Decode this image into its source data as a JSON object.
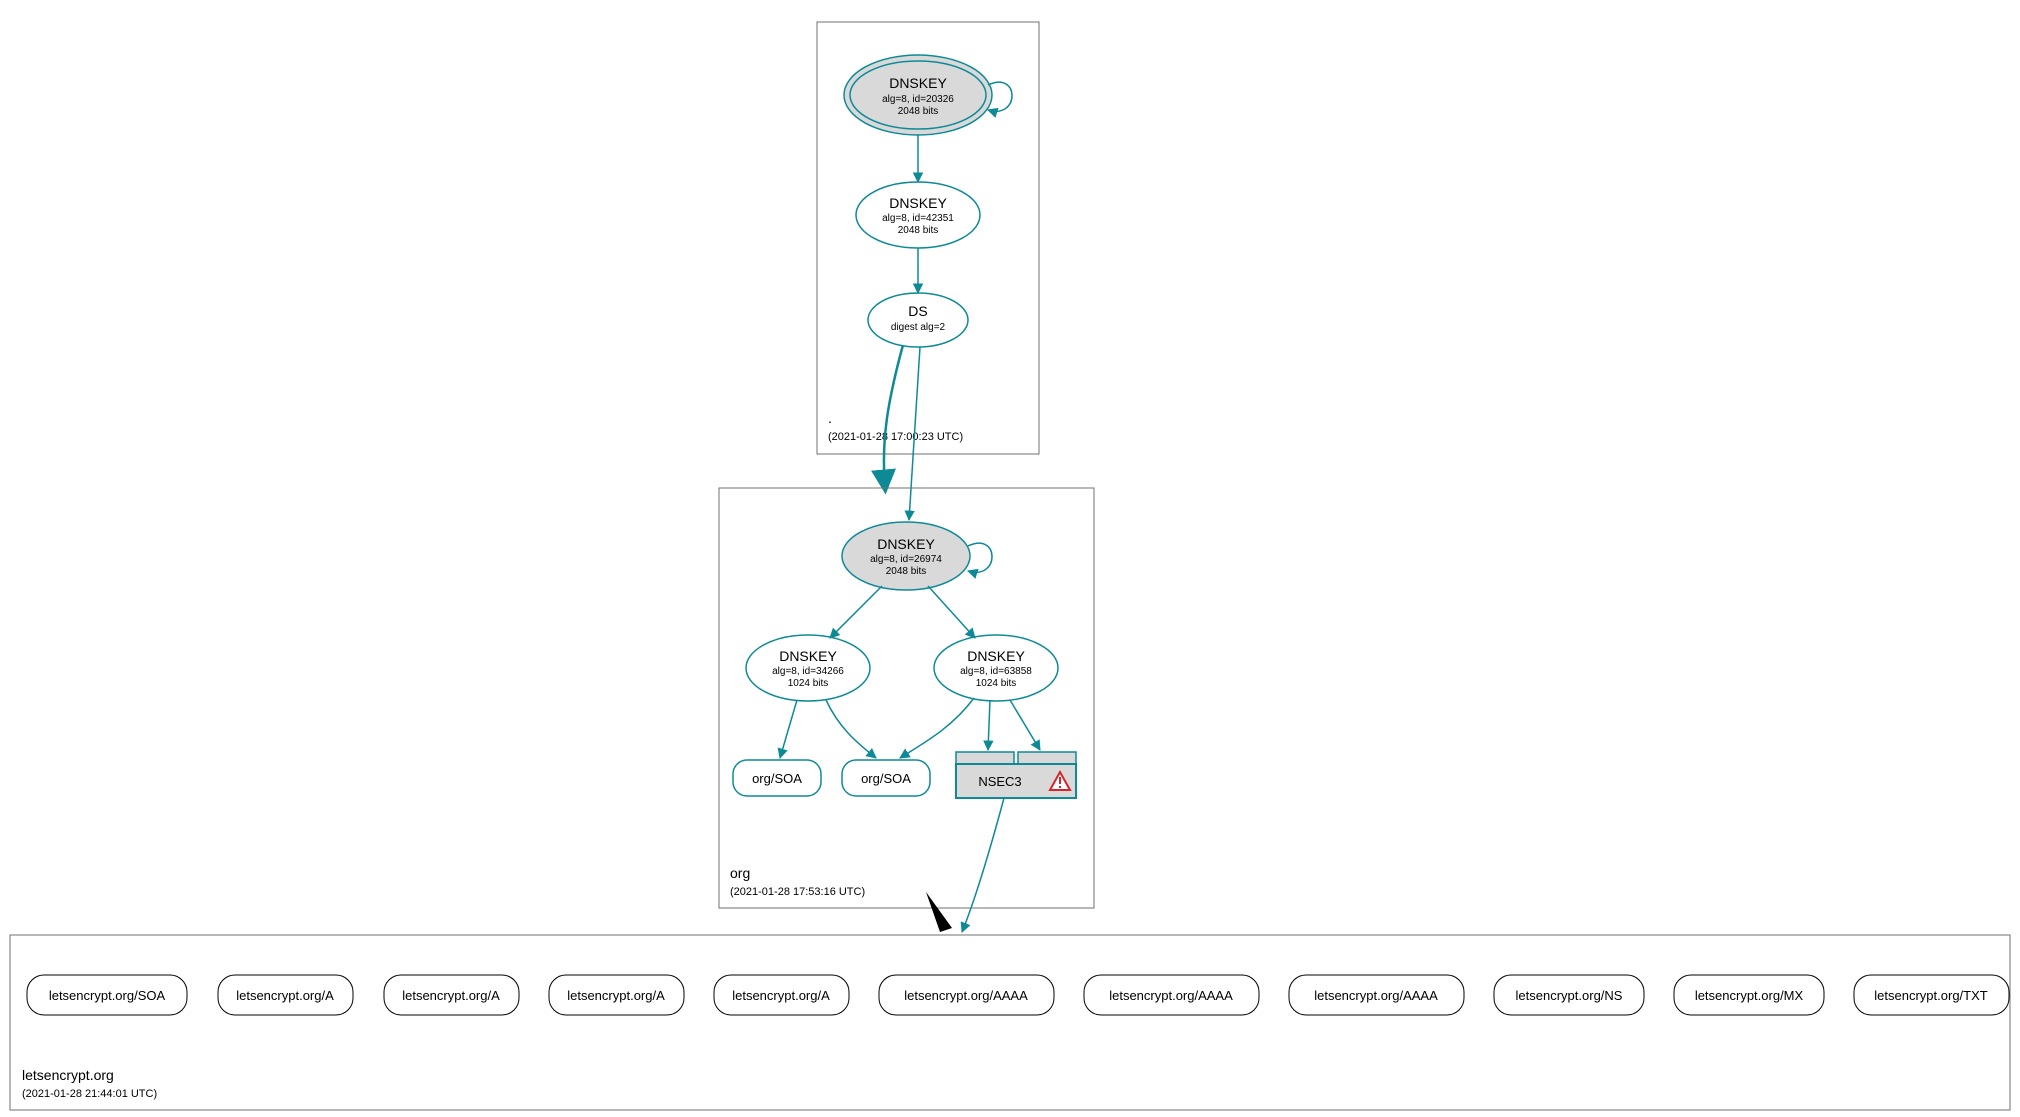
{
  "zones": {
    "root": {
      "name": ".",
      "timestamp": "(2021-01-28 17:00:23 UTC)",
      "ksk": {
        "title": "DNSKEY",
        "sub1": "alg=8, id=20326",
        "sub2": "2048 bits"
      },
      "zsk": {
        "title": "DNSKEY",
        "sub1": "alg=8, id=42351",
        "sub2": "2048 bits"
      },
      "ds": {
        "title": "DS",
        "sub1": "digest alg=2"
      }
    },
    "org": {
      "name": "org",
      "timestamp": "(2021-01-28 17:53:16 UTC)",
      "ksk": {
        "title": "DNSKEY",
        "sub1": "alg=8, id=26974",
        "sub2": "2048 bits"
      },
      "zsk1": {
        "title": "DNSKEY",
        "sub1": "alg=8, id=34266",
        "sub2": "1024 bits"
      },
      "zsk2": {
        "title": "DNSKEY",
        "sub1": "alg=8, id=63858",
        "sub2": "1024 bits"
      },
      "soa1": "org/SOA",
      "soa2": "org/SOA",
      "nsec3": "NSEC3"
    },
    "letsencrypt": {
      "name": "letsencrypt.org",
      "timestamp": "(2021-01-28 21:44:01 UTC)",
      "records": [
        "letsencrypt.org/SOA",
        "letsencrypt.org/A",
        "letsencrypt.org/A",
        "letsencrypt.org/A",
        "letsencrypt.org/A",
        "letsencrypt.org/AAAA",
        "letsencrypt.org/AAAA",
        "letsencrypt.org/AAAA",
        "letsencrypt.org/NS",
        "letsencrypt.org/MX",
        "letsencrypt.org/TXT"
      ]
    }
  },
  "colors": {
    "teal": "#0e8a97",
    "grayfill": "#d9d9d9",
    "nsec3fill": "#d9d9d9",
    "warning_red": "#d8232a"
  }
}
